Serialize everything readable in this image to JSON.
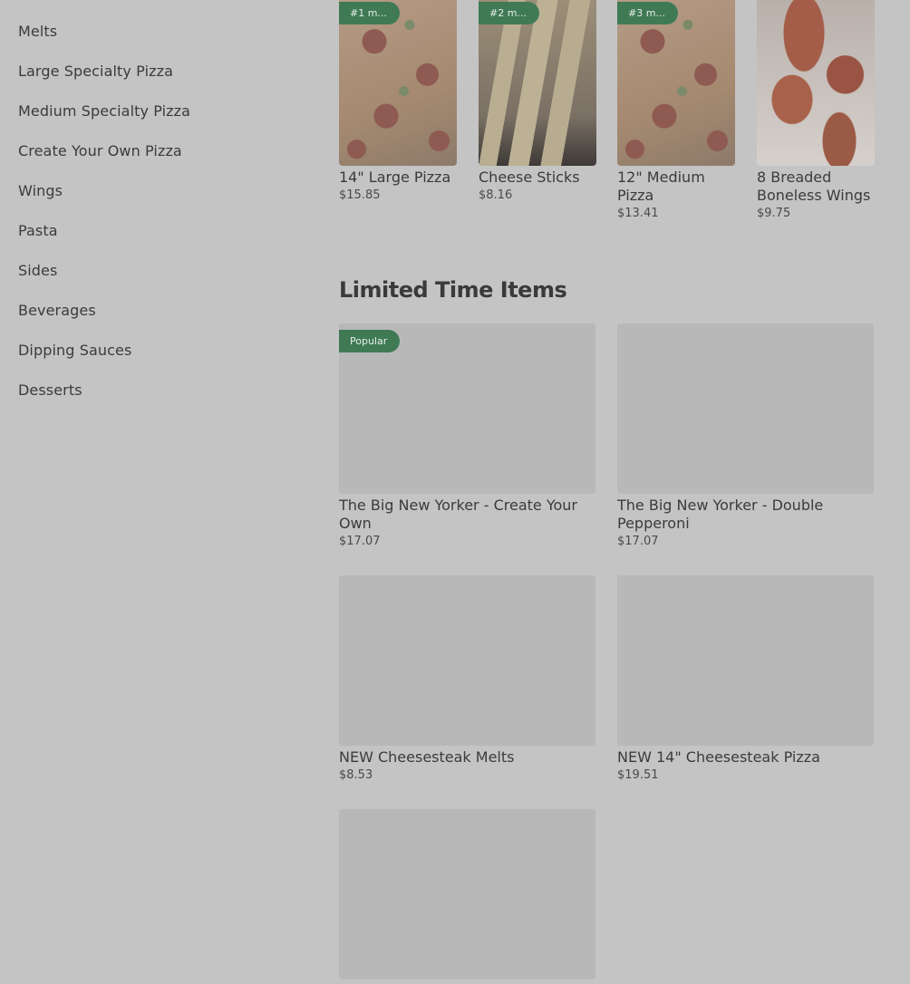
{
  "sidebar": {
    "items": [
      {
        "label": "Melts"
      },
      {
        "label": "Large Specialty Pizza"
      },
      {
        "label": "Medium Specialty Pizza"
      },
      {
        "label": "Create Your Own Pizza"
      },
      {
        "label": "Wings"
      },
      {
        "label": "Pasta"
      },
      {
        "label": "Sides"
      },
      {
        "label": "Beverages"
      },
      {
        "label": "Dipping Sauces"
      },
      {
        "label": "Desserts"
      }
    ]
  },
  "popular": {
    "items": [
      {
        "badge": "#1 m...",
        "name": "14\" Large Pizza",
        "price": "$15.85"
      },
      {
        "badge": "#2 m...",
        "name": "Cheese Sticks",
        "price": "$8.16"
      },
      {
        "badge": "#3 m...",
        "name": "12\" Medium Pizza",
        "price": "$13.41"
      },
      {
        "badge": "",
        "name": "8 Breaded Boneless Wings",
        "price": "$9.75"
      }
    ]
  },
  "limited": {
    "title": "Limited Time Items",
    "items": [
      {
        "badge": "Popular",
        "name": "The Big New Yorker - Create Your Own",
        "price": "$17.07"
      },
      {
        "badge": "",
        "name": "The Big New Yorker - Double Pepperoni",
        "price": "$17.07"
      },
      {
        "badge": "",
        "name": "NEW Cheesesteak Melts",
        "price": "$8.53"
      },
      {
        "badge": "",
        "name": "NEW 14\" Cheesesteak Pizza",
        "price": "$19.51"
      },
      {
        "badge": "",
        "name": "",
        "price": ""
      }
    ]
  },
  "colors": {
    "overlay_background": "#c4c4c4",
    "badge_green": "#3f7a55",
    "placeholder_gray": "#b8b8b8"
  }
}
